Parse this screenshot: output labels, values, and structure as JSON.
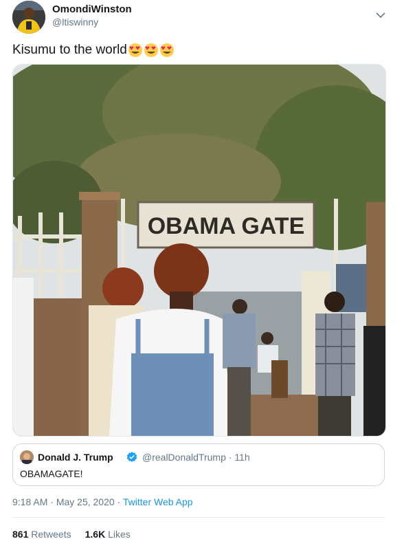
{
  "author": {
    "display_name": "OmondiWinston",
    "handle": "@ltiswinny",
    "avatar_icon": "profile-avatar-icon"
  },
  "tweet": {
    "text": "Kisumu to the world",
    "emojis": [
      "heart-eyes-emoji",
      "heart-eyes-emoji",
      "heart-eyes-emoji"
    ]
  },
  "photo": {
    "sign_text": "OBAMA GATE"
  },
  "quoted_tweet": {
    "display_name": "Donald J. Trump",
    "handle": "@realDonaldTrump",
    "separator": " · ",
    "time": "11h",
    "text": "OBAMAGATE!"
  },
  "meta": {
    "time": "9:18 AM",
    "date": "May 25, 2020",
    "separator": " · ",
    "app": "Twitter Web App"
  },
  "stats": {
    "retweets_count": "861",
    "retweets_label": "Retweets",
    "likes_count": "1.6K",
    "likes_label": "Likes"
  },
  "colors": {
    "link": "#1b95e0",
    "secondary_text": "#657786",
    "primary_text": "#14171a",
    "verified": "#1da1f2"
  }
}
